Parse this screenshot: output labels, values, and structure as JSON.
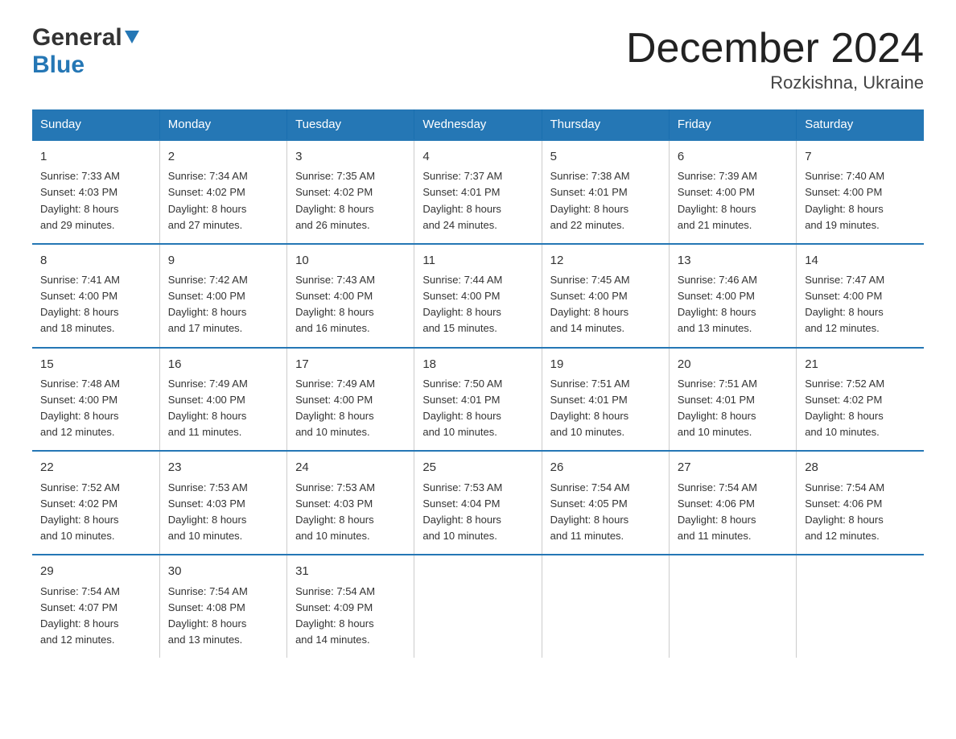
{
  "header": {
    "logo_general": "General",
    "logo_blue": "Blue",
    "title": "December 2024",
    "subtitle": "Rozkishna, Ukraine"
  },
  "days_of_week": [
    "Sunday",
    "Monday",
    "Tuesday",
    "Wednesday",
    "Thursday",
    "Friday",
    "Saturday"
  ],
  "weeks": [
    [
      {
        "day": "1",
        "info": "Sunrise: 7:33 AM\nSunset: 4:03 PM\nDaylight: 8 hours\nand 29 minutes."
      },
      {
        "day": "2",
        "info": "Sunrise: 7:34 AM\nSunset: 4:02 PM\nDaylight: 8 hours\nand 27 minutes."
      },
      {
        "day": "3",
        "info": "Sunrise: 7:35 AM\nSunset: 4:02 PM\nDaylight: 8 hours\nand 26 minutes."
      },
      {
        "day": "4",
        "info": "Sunrise: 7:37 AM\nSunset: 4:01 PM\nDaylight: 8 hours\nand 24 minutes."
      },
      {
        "day": "5",
        "info": "Sunrise: 7:38 AM\nSunset: 4:01 PM\nDaylight: 8 hours\nand 22 minutes."
      },
      {
        "day": "6",
        "info": "Sunrise: 7:39 AM\nSunset: 4:00 PM\nDaylight: 8 hours\nand 21 minutes."
      },
      {
        "day": "7",
        "info": "Sunrise: 7:40 AM\nSunset: 4:00 PM\nDaylight: 8 hours\nand 19 minutes."
      }
    ],
    [
      {
        "day": "8",
        "info": "Sunrise: 7:41 AM\nSunset: 4:00 PM\nDaylight: 8 hours\nand 18 minutes."
      },
      {
        "day": "9",
        "info": "Sunrise: 7:42 AM\nSunset: 4:00 PM\nDaylight: 8 hours\nand 17 minutes."
      },
      {
        "day": "10",
        "info": "Sunrise: 7:43 AM\nSunset: 4:00 PM\nDaylight: 8 hours\nand 16 minutes."
      },
      {
        "day": "11",
        "info": "Sunrise: 7:44 AM\nSunset: 4:00 PM\nDaylight: 8 hours\nand 15 minutes."
      },
      {
        "day": "12",
        "info": "Sunrise: 7:45 AM\nSunset: 4:00 PM\nDaylight: 8 hours\nand 14 minutes."
      },
      {
        "day": "13",
        "info": "Sunrise: 7:46 AM\nSunset: 4:00 PM\nDaylight: 8 hours\nand 13 minutes."
      },
      {
        "day": "14",
        "info": "Sunrise: 7:47 AM\nSunset: 4:00 PM\nDaylight: 8 hours\nand 12 minutes."
      }
    ],
    [
      {
        "day": "15",
        "info": "Sunrise: 7:48 AM\nSunset: 4:00 PM\nDaylight: 8 hours\nand 12 minutes."
      },
      {
        "day": "16",
        "info": "Sunrise: 7:49 AM\nSunset: 4:00 PM\nDaylight: 8 hours\nand 11 minutes."
      },
      {
        "day": "17",
        "info": "Sunrise: 7:49 AM\nSunset: 4:00 PM\nDaylight: 8 hours\nand 10 minutes."
      },
      {
        "day": "18",
        "info": "Sunrise: 7:50 AM\nSunset: 4:01 PM\nDaylight: 8 hours\nand 10 minutes."
      },
      {
        "day": "19",
        "info": "Sunrise: 7:51 AM\nSunset: 4:01 PM\nDaylight: 8 hours\nand 10 minutes."
      },
      {
        "day": "20",
        "info": "Sunrise: 7:51 AM\nSunset: 4:01 PM\nDaylight: 8 hours\nand 10 minutes."
      },
      {
        "day": "21",
        "info": "Sunrise: 7:52 AM\nSunset: 4:02 PM\nDaylight: 8 hours\nand 10 minutes."
      }
    ],
    [
      {
        "day": "22",
        "info": "Sunrise: 7:52 AM\nSunset: 4:02 PM\nDaylight: 8 hours\nand 10 minutes."
      },
      {
        "day": "23",
        "info": "Sunrise: 7:53 AM\nSunset: 4:03 PM\nDaylight: 8 hours\nand 10 minutes."
      },
      {
        "day": "24",
        "info": "Sunrise: 7:53 AM\nSunset: 4:03 PM\nDaylight: 8 hours\nand 10 minutes."
      },
      {
        "day": "25",
        "info": "Sunrise: 7:53 AM\nSunset: 4:04 PM\nDaylight: 8 hours\nand 10 minutes."
      },
      {
        "day": "26",
        "info": "Sunrise: 7:54 AM\nSunset: 4:05 PM\nDaylight: 8 hours\nand 11 minutes."
      },
      {
        "day": "27",
        "info": "Sunrise: 7:54 AM\nSunset: 4:06 PM\nDaylight: 8 hours\nand 11 minutes."
      },
      {
        "day": "28",
        "info": "Sunrise: 7:54 AM\nSunset: 4:06 PM\nDaylight: 8 hours\nand 12 minutes."
      }
    ],
    [
      {
        "day": "29",
        "info": "Sunrise: 7:54 AM\nSunset: 4:07 PM\nDaylight: 8 hours\nand 12 minutes."
      },
      {
        "day": "30",
        "info": "Sunrise: 7:54 AM\nSunset: 4:08 PM\nDaylight: 8 hours\nand 13 minutes."
      },
      {
        "day": "31",
        "info": "Sunrise: 7:54 AM\nSunset: 4:09 PM\nDaylight: 8 hours\nand 14 minutes."
      },
      {
        "day": "",
        "info": ""
      },
      {
        "day": "",
        "info": ""
      },
      {
        "day": "",
        "info": ""
      },
      {
        "day": "",
        "info": ""
      }
    ]
  ]
}
